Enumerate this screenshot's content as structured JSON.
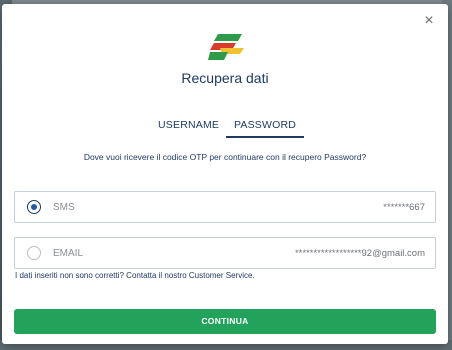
{
  "modal": {
    "close_label": "×",
    "title": "Recupera dati",
    "tabs": [
      {
        "label": "USERNAME",
        "active": false
      },
      {
        "label": "PASSWORD",
        "active": true
      }
    ],
    "prompt": "Dove vuoi ricevere il codice OTP per continuare con il recupero Password?",
    "options": [
      {
        "label": "SMS",
        "value": "*******667",
        "selected": true
      },
      {
        "label": "EMAIL",
        "value": "******************92@gmail.com",
        "selected": false
      }
    ],
    "note": "I dati inseriti non sono corretti? Contatta il nostro Customer Service.",
    "continue_label": "CONTINUA"
  },
  "colors": {
    "primary_navy": "#1f3a64",
    "button_green": "#22a25a",
    "logo_green": "#2e9a4a",
    "logo_red": "#d93a2b",
    "logo_yellow": "#f2c230"
  },
  "icons": {
    "logo": "brand-flag-logo",
    "close": "close-icon",
    "radio": "radio-button"
  }
}
